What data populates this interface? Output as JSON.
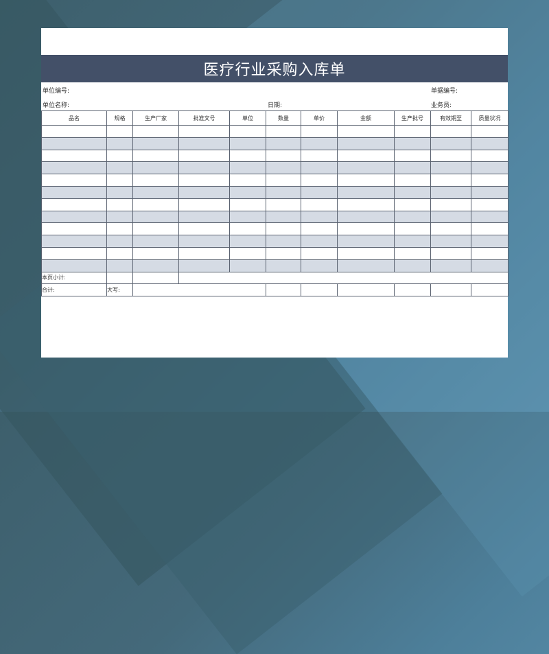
{
  "title": "医疗行业采购入库单",
  "meta": {
    "unit_no_label": "单位编号:",
    "doc_no_label": "单据编号:",
    "unit_name_label": "单位名称:",
    "date_label": "日期:",
    "salesperson_label": "业务员:"
  },
  "table": {
    "headers": [
      "品名",
      "规格",
      "生产厂家",
      "批准文号",
      "单位",
      "数量",
      "单价",
      "金额",
      "生产批号",
      "有效期至",
      "质量状况"
    ],
    "body_rows": 12,
    "footer": {
      "subtotal_label": "本页小计:",
      "total_label": "合计:",
      "capital_label": "大写:"
    }
  },
  "colors": {
    "title_bg": "#435068",
    "row_shade": "#d5dbe4",
    "border": "#5a6270"
  }
}
